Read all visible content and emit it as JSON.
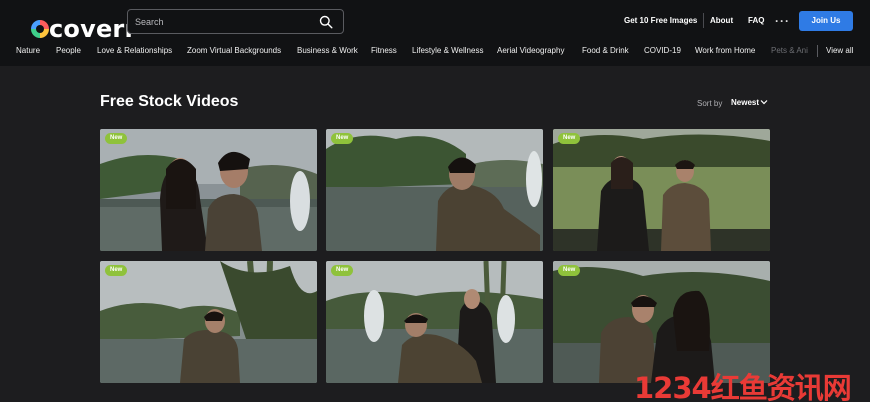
{
  "brand": {
    "logo_text": "coverr"
  },
  "search": {
    "placeholder": "Search"
  },
  "nav": {
    "get_images": "Get 10 Free Images",
    "about": "About",
    "faq": "FAQ",
    "more": "···",
    "join": "Join Us"
  },
  "categories": {
    "items": [
      "Nature",
      "People",
      "Love & Relationships",
      "Zoom Virtual Backgrounds",
      "Business & Work",
      "Fitness",
      "Lifestyle & Wellness",
      "Aerial Videography",
      "Food & Drink",
      "COVID-19",
      "Work from Home",
      "Pets & Ani"
    ],
    "view_all": "View all"
  },
  "main": {
    "title": "Free Stock Videos",
    "sort_label": "Sort by",
    "sort_value": "Newest"
  },
  "videos": [
    {
      "badge": "New",
      "scene": "couple-by-fountain"
    },
    {
      "badge": "New",
      "scene": "man-leaning-rail"
    },
    {
      "badge": "New",
      "scene": "couple-walking-lawn"
    },
    {
      "badge": "New",
      "scene": "man-kneeling-palms"
    },
    {
      "badge": "New",
      "scene": "man-bending-fountain"
    },
    {
      "badge": "New",
      "scene": "couple-garden"
    }
  ],
  "watermark": {
    "text": "1234红鱼资讯网"
  },
  "colors": {
    "accent": "#2f7be5",
    "badge": "#8fc23b",
    "watermark": "#e93a36"
  }
}
